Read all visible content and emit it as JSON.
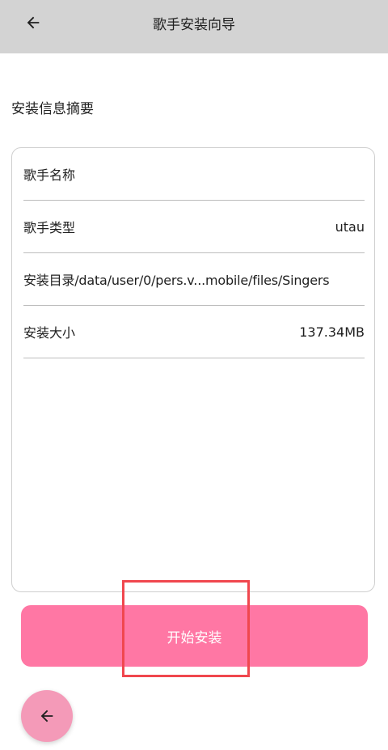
{
  "app_bar": {
    "title": "歌手安装向导",
    "back_icon": "arrow-left-icon"
  },
  "section": {
    "title": "安装信息摘要"
  },
  "info": {
    "singer_name": {
      "label": "歌手名称",
      "value": ""
    },
    "singer_type": {
      "label": "歌手类型",
      "value": "utau"
    },
    "install_dir": {
      "label": "安装目录/data/user/0/pers.v...mobile/files/Singers"
    },
    "install_size": {
      "label": "安装大小",
      "value": "137.34MB"
    }
  },
  "actions": {
    "install_label": "开始安装",
    "fab_icon": "arrow-left-icon"
  },
  "colors": {
    "app_bar": "#d3d3d3",
    "install_button": "#ff77a4",
    "fab": "#f49ab8",
    "highlight": "#f0474e"
  }
}
